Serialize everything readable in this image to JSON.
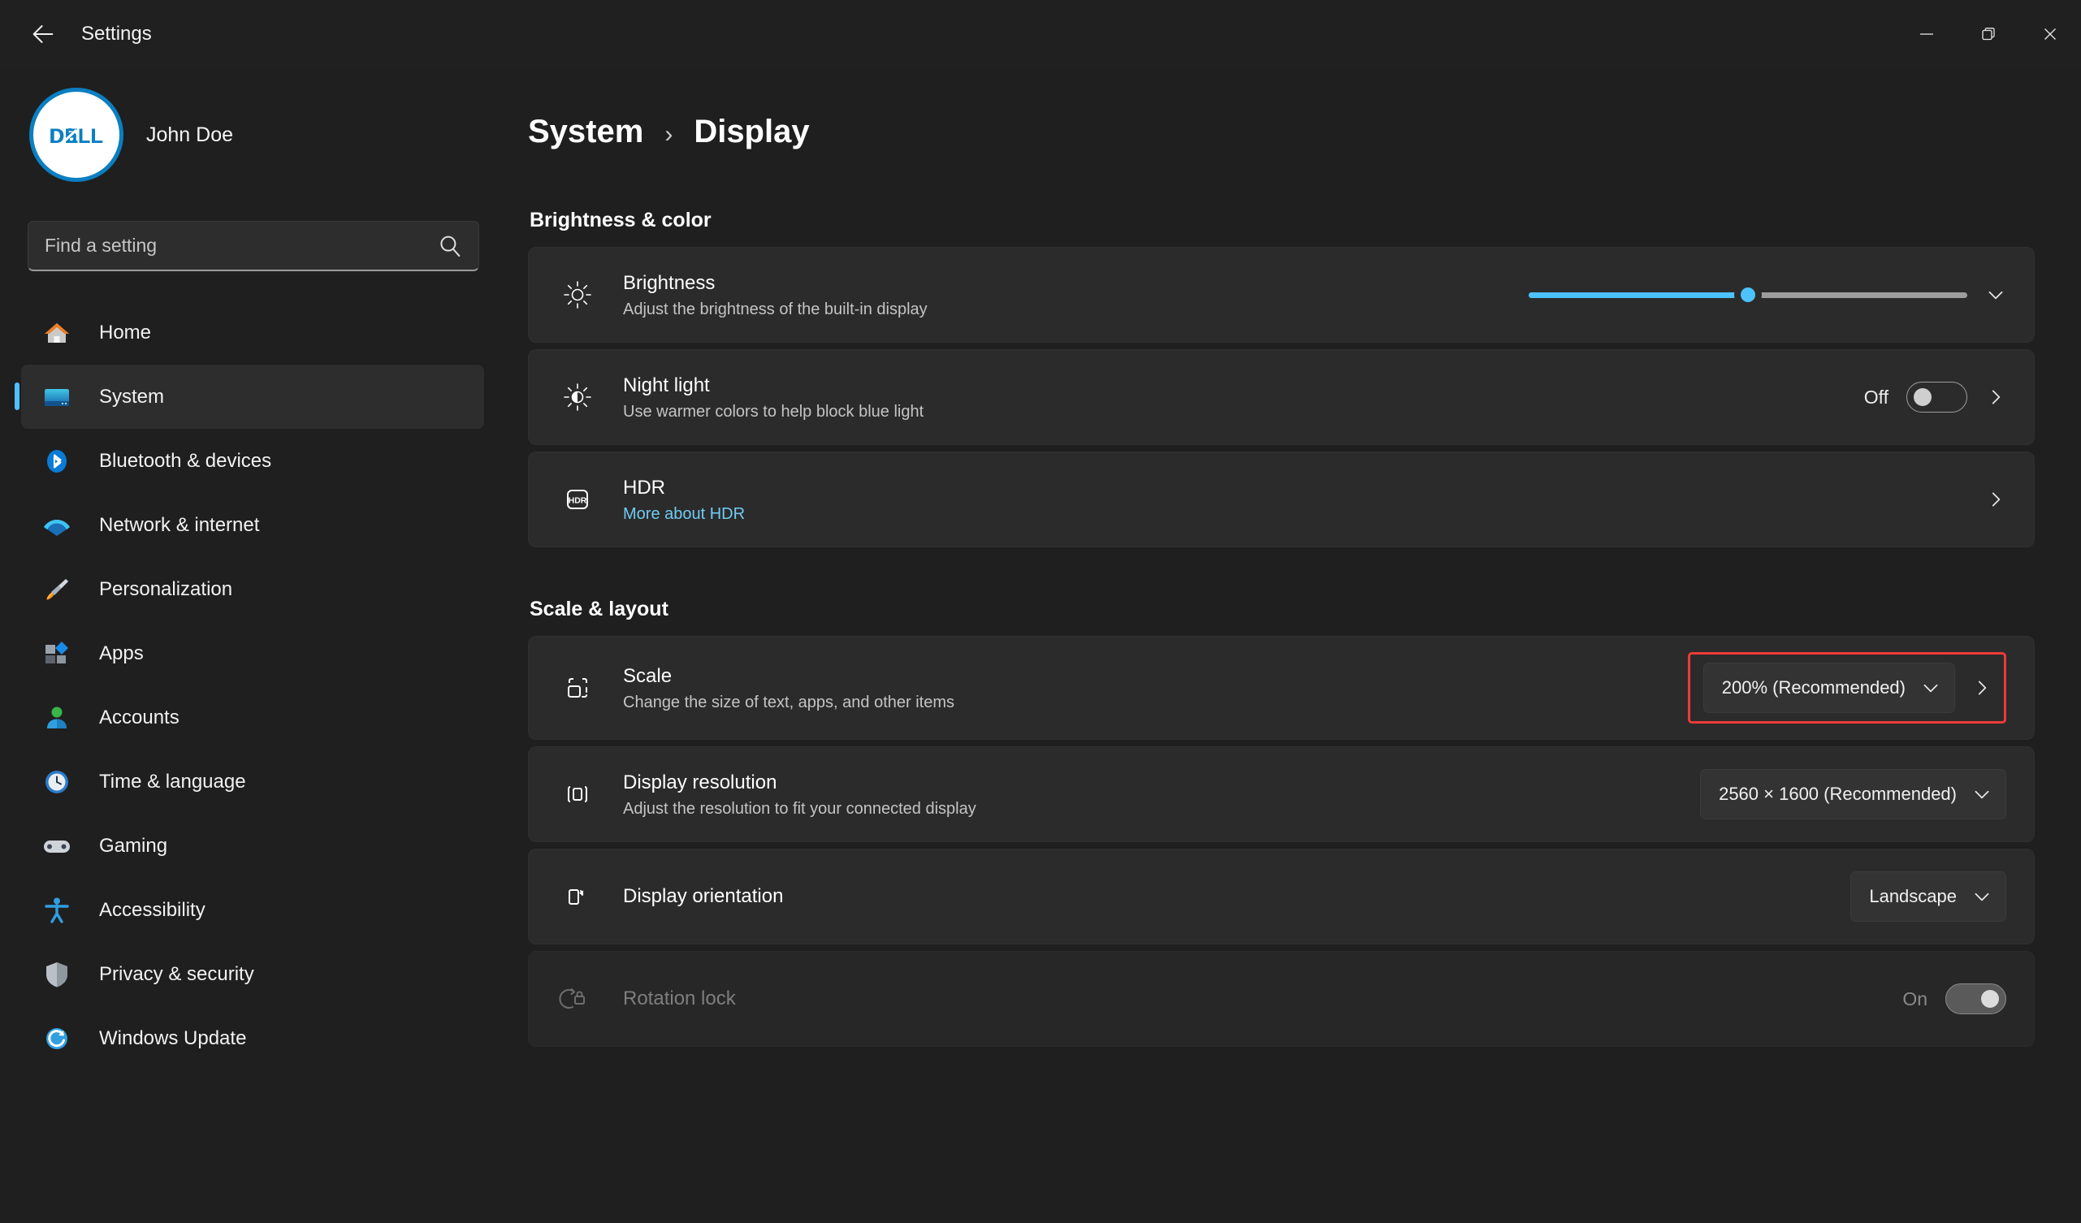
{
  "titlebar": {
    "back_label": "Back",
    "title": "Settings",
    "minimize_label": "Minimize",
    "restore_label": "Restore",
    "close_label": "Close"
  },
  "sidebar": {
    "profile_name": "John Doe",
    "avatar_brand": "DELL",
    "search_placeholder": "Find a setting",
    "search_value": "",
    "items": [
      {
        "label": "Home",
        "icon": "home-icon",
        "selected": false
      },
      {
        "label": "System",
        "icon": "system-icon",
        "selected": true
      },
      {
        "label": "Bluetooth & devices",
        "icon": "bluetooth-icon",
        "selected": false
      },
      {
        "label": "Network & internet",
        "icon": "wifi-icon",
        "selected": false
      },
      {
        "label": "Personalization",
        "icon": "paintbrush-icon",
        "selected": false
      },
      {
        "label": "Apps",
        "icon": "apps-icon",
        "selected": false
      },
      {
        "label": "Accounts",
        "icon": "accounts-icon",
        "selected": false
      },
      {
        "label": "Time & language",
        "icon": "clock-icon",
        "selected": false
      },
      {
        "label": "Gaming",
        "icon": "gaming-icon",
        "selected": false
      },
      {
        "label": "Accessibility",
        "icon": "accessibility-icon",
        "selected": false
      },
      {
        "label": "Privacy & security",
        "icon": "shield-icon",
        "selected": false
      },
      {
        "label": "Windows Update",
        "icon": "update-icon",
        "selected": false
      }
    ]
  },
  "breadcrumb": {
    "root": "System",
    "separator": "›",
    "current": "Display"
  },
  "sections": [
    {
      "title": "Brightness & color"
    },
    {
      "title": "Scale & layout"
    }
  ],
  "brightness": {
    "title": "Brightness",
    "subtitle": "Adjust the brightness of the built-in display",
    "slider_value": 50,
    "expand_label": "Expand"
  },
  "night_light": {
    "title": "Night light",
    "subtitle": "Use warmer colors to help block blue light",
    "state": "Off",
    "toggle_on": false
  },
  "hdr": {
    "title": "HDR",
    "link": "More about HDR"
  },
  "scale": {
    "title": "Scale",
    "subtitle": "Change the size of text, apps, and other items",
    "value": "200% (Recommended)",
    "highlighted": true
  },
  "resolution": {
    "title": "Display resolution",
    "subtitle": "Adjust the resolution to fit your connected display",
    "value": "2560 × 1600 (Recommended)"
  },
  "orientation": {
    "title": "Display orientation",
    "value": "Landscape"
  },
  "rotation_lock": {
    "title": "Rotation lock",
    "state": "On",
    "toggle_on": true,
    "disabled": true
  },
  "colors": {
    "accent": "#4cc2ff",
    "link": "#71cbf4",
    "highlight": "#ef3b38",
    "background": "#1f1f1f",
    "card": "#2b2b2b",
    "dell_blue": "#0b7fc1"
  }
}
